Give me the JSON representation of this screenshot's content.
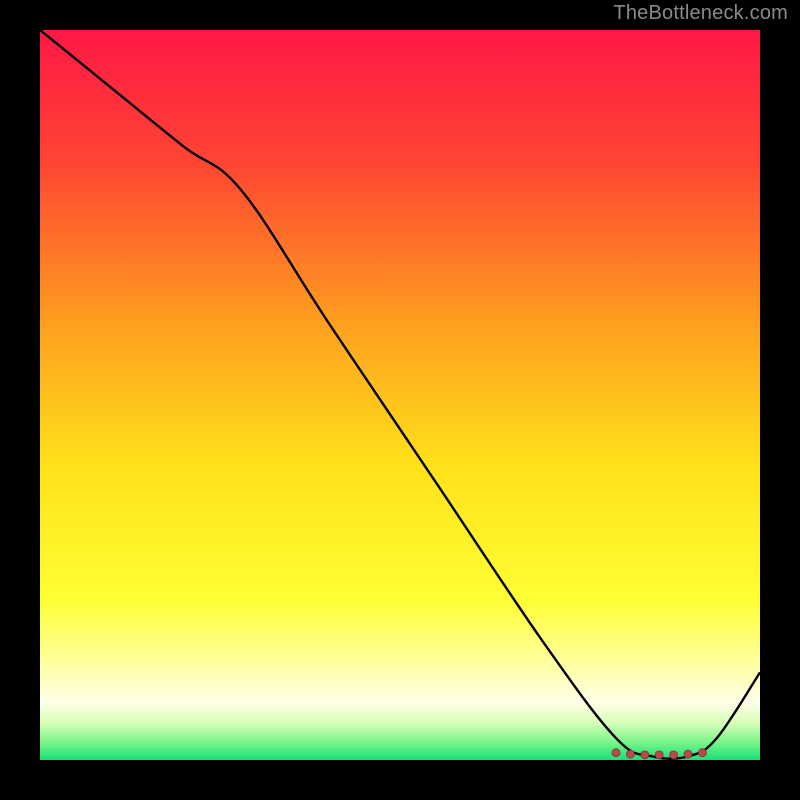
{
  "attribution": "TheBottleneck.com",
  "gradient": {
    "stops": [
      {
        "offset": 0.0,
        "color": "#ff1846"
      },
      {
        "offset": 0.18,
        "color": "#ff4433"
      },
      {
        "offset": 0.4,
        "color": "#ff9e1f"
      },
      {
        "offset": 0.6,
        "color": "#ffe21a"
      },
      {
        "offset": 0.78,
        "color": "#ffff33"
      },
      {
        "offset": 0.88,
        "color": "#ffffb0"
      },
      {
        "offset": 0.92,
        "color": "#ffffe8"
      },
      {
        "offset": 0.95,
        "color": "#d6ffb8"
      },
      {
        "offset": 0.975,
        "color": "#7cf58a"
      },
      {
        "offset": 1.0,
        "color": "#18e07a"
      }
    ]
  },
  "chart_data": {
    "type": "line",
    "title": "",
    "xlabel": "",
    "ylabel": "",
    "xlim": [
      0,
      100
    ],
    "ylim": [
      0,
      100
    ],
    "grid": false,
    "series": [
      {
        "name": "curve",
        "x": [
          0,
          10,
          20,
          28,
          40,
          55,
          70,
          80,
          85,
          90,
          94,
          100
        ],
        "values": [
          100,
          92,
          84,
          78,
          60,
          38,
          16,
          3,
          0.5,
          0.5,
          3,
          12
        ]
      }
    ],
    "markers": {
      "name": "ideal-range",
      "x": [
        80,
        82,
        84,
        86,
        88,
        90,
        92
      ],
      "values": [
        1.0,
        0.8,
        0.7,
        0.7,
        0.7,
        0.8,
        1.0
      ],
      "color": "#b84a4a",
      "radius": 4
    }
  }
}
